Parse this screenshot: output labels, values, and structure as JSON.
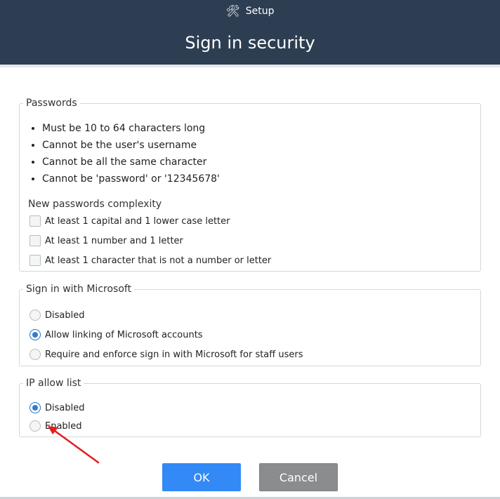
{
  "header": {
    "section_label": "Setup",
    "title": "Sign in security"
  },
  "passwords": {
    "legend": "Passwords",
    "rules": [
      "Must be 10 to 64 characters long",
      "Cannot be the user's username",
      "Cannot be all the same character",
      "Cannot be 'password' or '12345678'"
    ],
    "complexity_heading": "New passwords complexity",
    "complexity_options": [
      {
        "label": "At least 1 capital and 1 lower case letter",
        "checked": false
      },
      {
        "label": "At least 1 number and 1 letter",
        "checked": false
      },
      {
        "label": "At least 1 character that is not a number or letter",
        "checked": false
      }
    ]
  },
  "microsoft": {
    "legend": "Sign in with Microsoft",
    "options": [
      {
        "label": "Disabled",
        "selected": false
      },
      {
        "label": "Allow linking of Microsoft accounts",
        "selected": true
      },
      {
        "label": "Require and enforce sign in with Microsoft for staff users",
        "selected": false
      }
    ]
  },
  "ip_allow_list": {
    "legend": "IP allow list",
    "options": [
      {
        "label": "Disabled",
        "selected": true
      },
      {
        "label": "Enabled",
        "selected": false
      }
    ]
  },
  "buttons": {
    "ok": "OK",
    "cancel": "Cancel"
  },
  "colors": {
    "header_bg": "#2e3e52",
    "ok_button": "#3389f5",
    "cancel_button": "#8a8c8e",
    "radio_selected": "#2e7dd1",
    "annotation_arrow": "#e02020"
  },
  "icons": {
    "header_icon": "tools-icon"
  }
}
